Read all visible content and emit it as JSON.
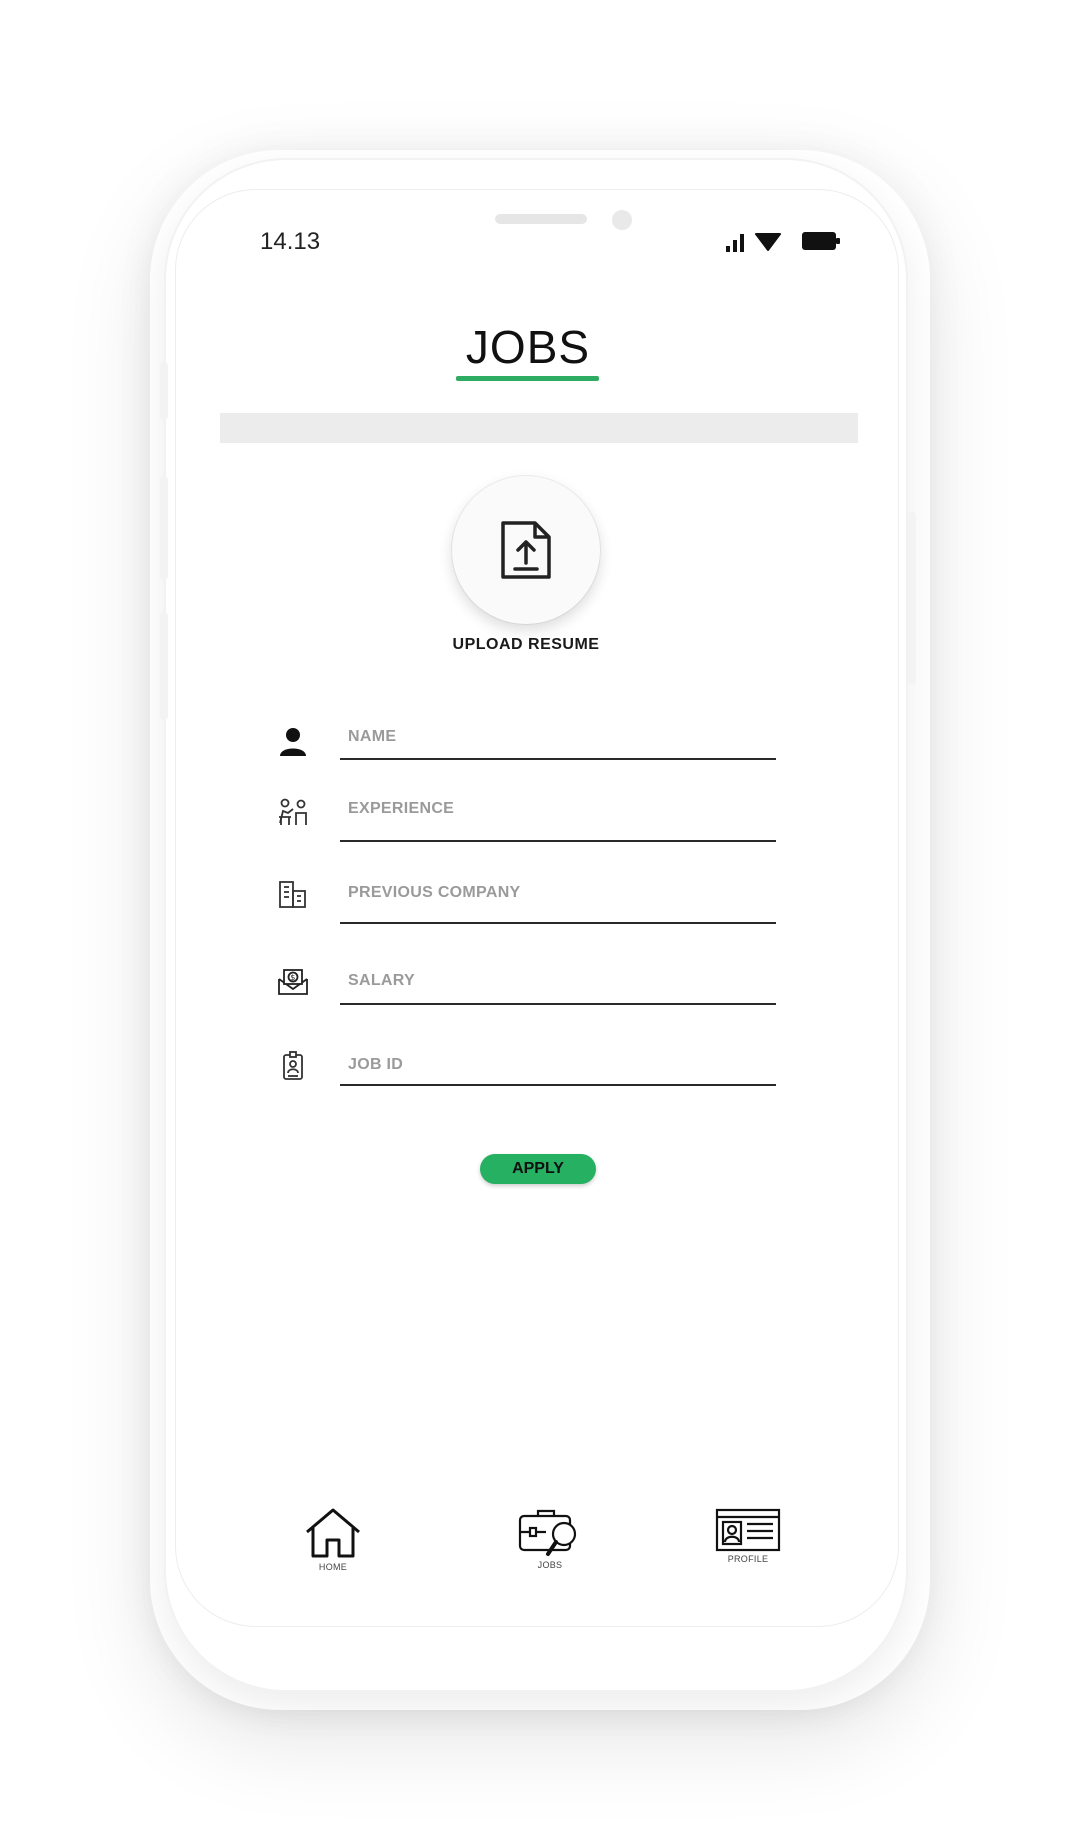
{
  "status_bar": {
    "time": "14.13"
  },
  "header": {
    "title": "JOBS"
  },
  "upload": {
    "label": "UPLOAD RESUME"
  },
  "form": {
    "fields": [
      {
        "placeholder": "NAME",
        "value": "",
        "icon": "person-icon"
      },
      {
        "placeholder": "EXPERIENCE",
        "value": "",
        "icon": "experience-icon"
      },
      {
        "placeholder": "PREVIOUS COMPANY",
        "value": "",
        "icon": "building-icon"
      },
      {
        "placeholder": "SALARY",
        "value": "",
        "icon": "salary-icon"
      },
      {
        "placeholder": "JOB ID",
        "value": "",
        "icon": "id-badge-icon"
      }
    ],
    "apply_label": "APPLY"
  },
  "bottom_nav": {
    "items": [
      {
        "label": "HOME",
        "icon": "home-icon"
      },
      {
        "label": "JOBS",
        "icon": "jobs-search-icon"
      },
      {
        "label": "PROFILE",
        "icon": "profile-card-icon"
      }
    ]
  },
  "colors": {
    "accent": "#2eac63",
    "button": "#26b061",
    "divider": "#ececec"
  }
}
